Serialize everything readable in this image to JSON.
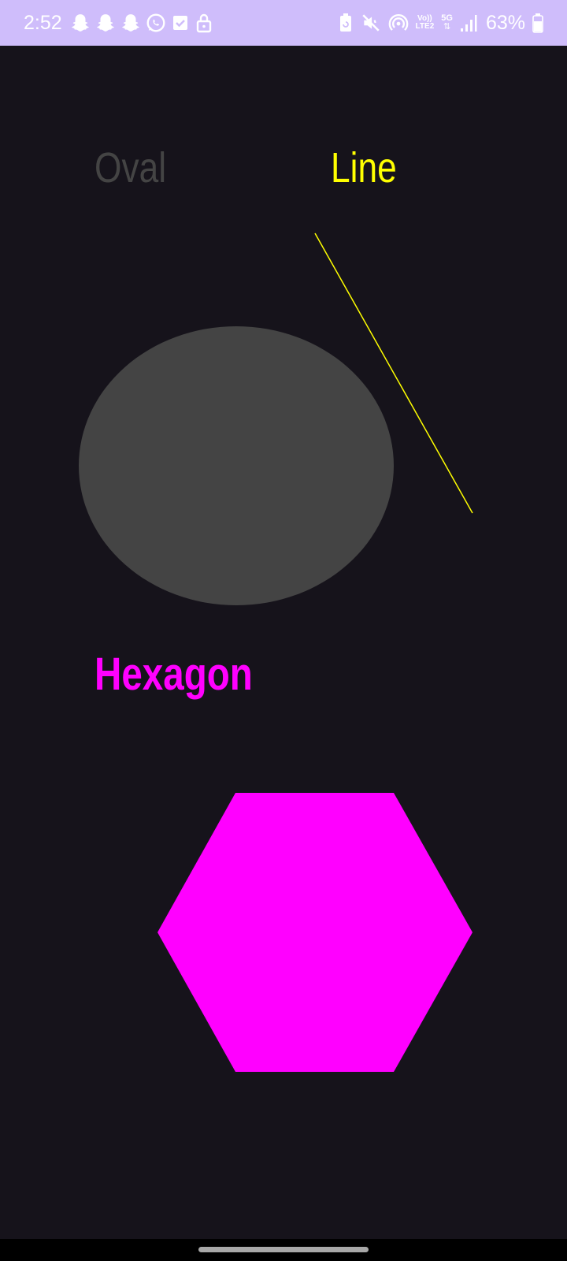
{
  "status_bar": {
    "time": "2:52",
    "battery_percent": "63%",
    "network_label_top": "Vo))",
    "network_label_bottom": "LTE2",
    "network_5g": "5G",
    "background_color": "#cfbdfb",
    "left_icons": [
      "snapchat-icon",
      "snapchat-icon",
      "snapchat-icon",
      "whatsapp-icon",
      "checkbox-icon",
      "lock-icon"
    ],
    "right_icons": [
      "battery-saver-icon",
      "mute-icon",
      "hotspot-icon",
      "volte-icon",
      "5g-icon",
      "signal-icon",
      "battery-icon"
    ]
  },
  "shapes": {
    "oval": {
      "label": "Oval",
      "color": "#444444"
    },
    "line": {
      "label": "Line",
      "color": "#ffff00"
    },
    "hexagon": {
      "label": "Hexagon",
      "color": "#ff00ff"
    }
  },
  "background_color": "#16131b"
}
